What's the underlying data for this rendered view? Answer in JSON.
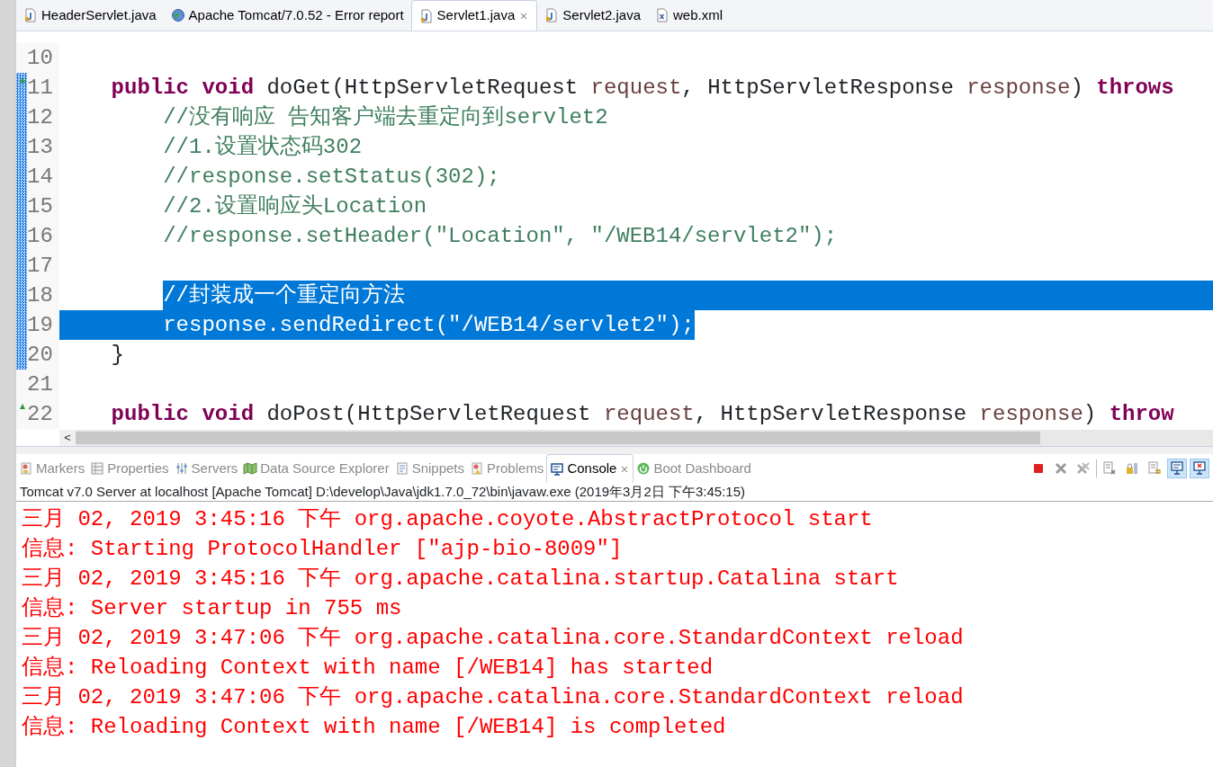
{
  "editor_tabs": [
    {
      "label": "HeaderServlet.java",
      "kind": "java",
      "selected": false,
      "closable": false
    },
    {
      "label": "Apache Tomcat/7.0.52 - Error report",
      "kind": "web",
      "selected": false,
      "closable": false
    },
    {
      "label": "Servlet1.java",
      "kind": "java",
      "selected": true,
      "closable": true
    },
    {
      "label": "Servlet2.java",
      "kind": "java",
      "selected": false,
      "closable": false
    },
    {
      "label": "web.xml",
      "kind": "xml",
      "selected": false,
      "closable": false
    }
  ],
  "code_lines": [
    {
      "number": "10",
      "range": false,
      "override": false,
      "selected": false
    },
    {
      "number": "11",
      "range": true,
      "override": true,
      "selected": false,
      "tokens": [
        {
          "text": "    public",
          "kind": "keyword"
        },
        {
          "text": " void",
          "kind": "keyword"
        },
        {
          "text": " doGet(HttpServletRequest ",
          "kind": "plain"
        },
        {
          "text": "request",
          "kind": "param"
        },
        {
          "text": ", HttpServletResponse ",
          "kind": "plain"
        },
        {
          "text": "response",
          "kind": "param"
        },
        {
          "text": ") ",
          "kind": "plain"
        },
        {
          "text": "throws",
          "kind": "keyword"
        }
      ]
    },
    {
      "number": "12",
      "range": true,
      "override": false,
      "selected": false,
      "tokens": [
        {
          "text": "        //没有响应 告知客户端去重定向到servlet2",
          "kind": "comment"
        }
      ]
    },
    {
      "number": "13",
      "range": true,
      "override": false,
      "selected": false,
      "tokens": [
        {
          "text": "        //1.设置状态码302",
          "kind": "comment"
        }
      ]
    },
    {
      "number": "14",
      "range": true,
      "override": false,
      "selected": false,
      "tokens": [
        {
          "text": "        //response.setStatus(302);",
          "kind": "comment"
        }
      ]
    },
    {
      "number": "15",
      "range": true,
      "override": false,
      "selected": false,
      "tokens": [
        {
          "text": "        //2.设置响应头Location",
          "kind": "comment"
        }
      ]
    },
    {
      "number": "16",
      "range": true,
      "override": false,
      "selected": false,
      "tokens": [
        {
          "text": "        //response.setHeader(\"Location\", \"/WEB14/servlet2\");",
          "kind": "comment"
        }
      ]
    },
    {
      "number": "17",
      "range": true,
      "override": false,
      "selected": false
    },
    {
      "number": "18",
      "range": true,
      "override": false,
      "selected": true,
      "tokens": [
        {
          "text": "        //封装成一个重定向方法",
          "kind": "comment"
        }
      ]
    },
    {
      "number": "19",
      "range": true,
      "override": false,
      "selected": true,
      "tokens": [
        {
          "text": "        response.sendRedirect(\"/WEB14/servlet2\");",
          "kind": "plain"
        }
      ]
    },
    {
      "number": "20",
      "range": true,
      "override": false,
      "selected": false,
      "tokens": [
        {
          "text": "    }",
          "kind": "plain"
        }
      ]
    },
    {
      "number": "21",
      "range": false,
      "override": false,
      "selected": false
    },
    {
      "number": "22",
      "range": false,
      "override": true,
      "selected": false,
      "tokens": [
        {
          "text": "    public",
          "kind": "keyword"
        },
        {
          "text": " void",
          "kind": "keyword"
        },
        {
          "text": " doPost(HttpServletRequest ",
          "kind": "plain"
        },
        {
          "text": "request",
          "kind": "param"
        },
        {
          "text": ", HttpServletResponse ",
          "kind": "plain"
        },
        {
          "text": "response",
          "kind": "param"
        },
        {
          "text": ") ",
          "kind": "plain"
        },
        {
          "text": "throw",
          "kind": "keyword"
        }
      ]
    }
  ],
  "scrollbar_button": "<",
  "view_tabs": [
    {
      "label": "Markers",
      "kind": "markers",
      "selected": false,
      "closable": false
    },
    {
      "label": "Properties",
      "kind": "properties",
      "selected": false,
      "closable": false
    },
    {
      "label": "Servers",
      "kind": "servers",
      "selected": false,
      "closable": false
    },
    {
      "label": "Data Source Explorer",
      "kind": "datasource",
      "selected": false,
      "closable": false
    },
    {
      "label": "Snippets",
      "kind": "snippets",
      "selected": false,
      "closable": false
    },
    {
      "label": "Problems",
      "kind": "problems",
      "selected": false,
      "closable": false
    },
    {
      "label": "Console",
      "kind": "console",
      "selected": true,
      "closable": true
    },
    {
      "label": "Boot Dashboard",
      "kind": "boot",
      "selected": false,
      "closable": false
    }
  ],
  "console_toolbar": [
    {
      "kind": "stop",
      "pressed": false
    },
    {
      "kind": "remove",
      "pressed": false
    },
    {
      "kind": "remove-all",
      "pressed": false
    },
    {
      "kind": "separator"
    },
    {
      "kind": "clear",
      "pressed": false
    },
    {
      "kind": "lock",
      "pressed": false
    },
    {
      "kind": "wrap",
      "pressed": false
    },
    {
      "kind": "show-out",
      "pressed": true
    },
    {
      "kind": "show-err",
      "pressed": true
    }
  ],
  "console_description": "Tomcat v7.0 Server at localhost [Apache Tomcat] D:\\develop\\Java\\jdk1.7.0_72\\bin\\javaw.exe (2019年3月2日 下午3:45:15)",
  "console_lines": [
    "三月 02, 2019 3:45:16 下午 org.apache.coyote.AbstractProtocol start",
    "信息: Starting ProtocolHandler [\"ajp-bio-8009\"]",
    "三月 02, 2019 3:45:16 下午 org.apache.catalina.startup.Catalina start",
    "信息: Server startup in 755 ms",
    "三月 02, 2019 3:47:06 下午 org.apache.catalina.core.StandardContext reload",
    "信息: Reloading Context with name [/WEB14] has started",
    "三月 02, 2019 3:47:06 下午 org.apache.catalina.core.StandardContext reload",
    "信息: Reloading Context with name [/WEB14] is completed"
  ]
}
